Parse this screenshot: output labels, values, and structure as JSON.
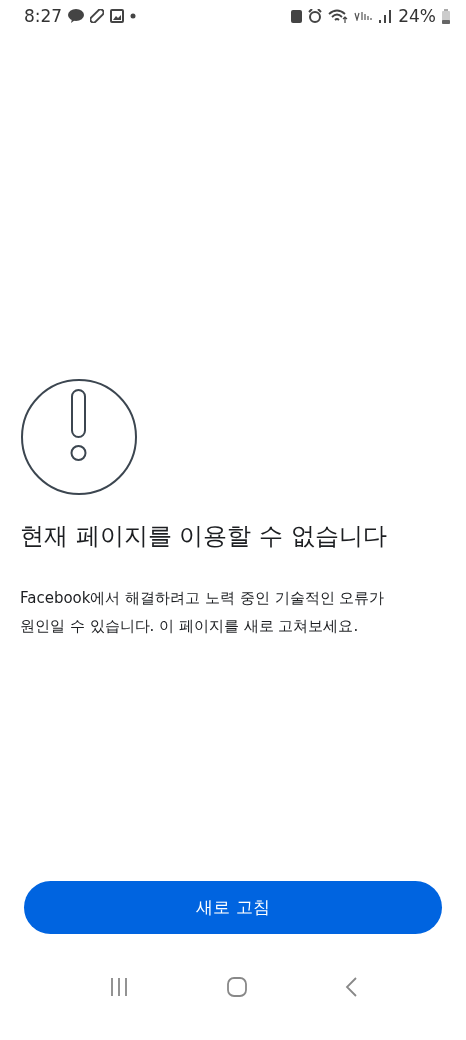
{
  "status_bar": {
    "time": "8:27",
    "battery": "24%"
  },
  "error": {
    "title": "현재 페이지를 이용할 수 없습니다",
    "message": "Facebook에서 해결하려고 노력 중인 기술적인 오류가\n원인일 수 있습니다. 이 페이지를 새로 고쳐보세요."
  },
  "button": {
    "label": "새로 고침"
  }
}
